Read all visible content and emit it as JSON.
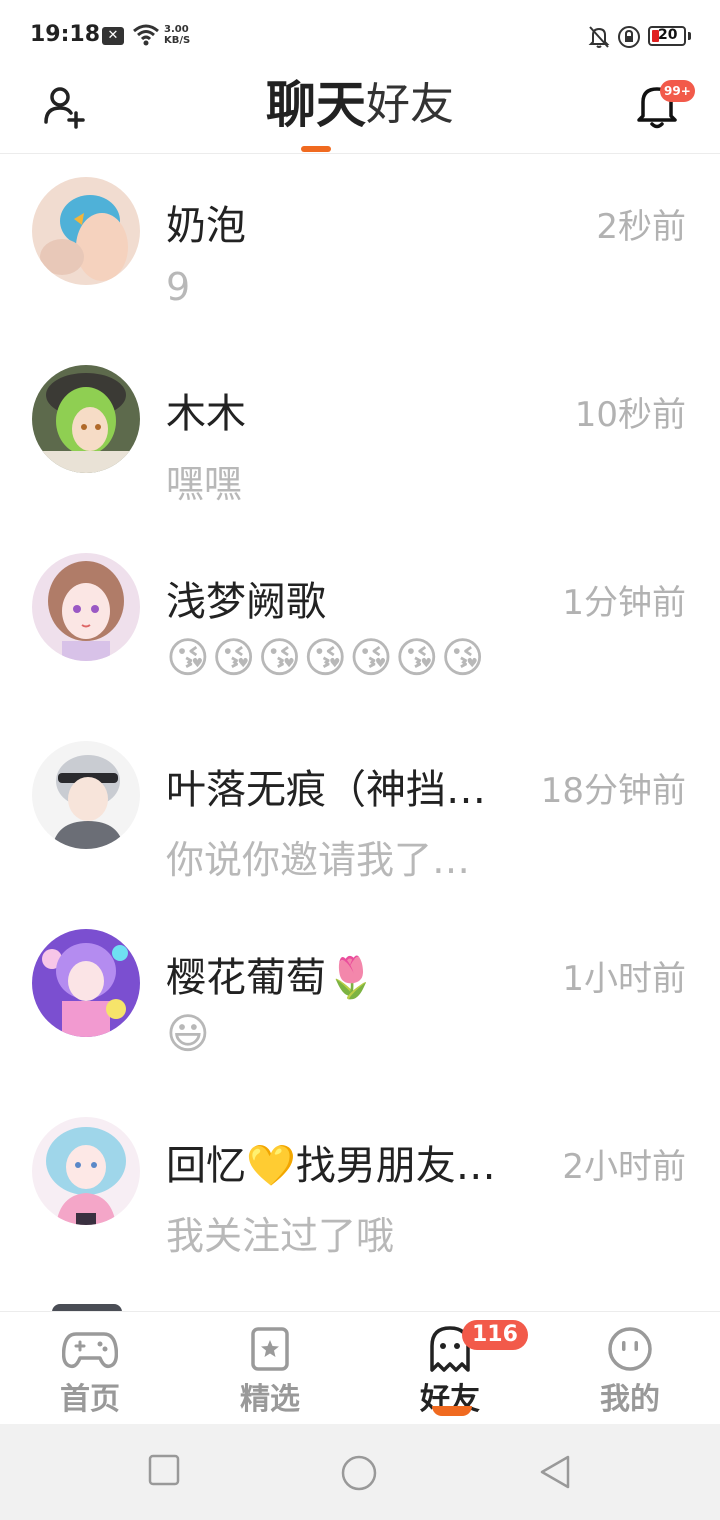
{
  "status_bar": {
    "time": "19:18",
    "notification_glyph": "✕",
    "net_speed_value": "3.00",
    "net_speed_unit": "KB/S",
    "battery": "20"
  },
  "header": {
    "tabs": [
      {
        "label": "聊天",
        "active": true
      },
      {
        "label": "好友",
        "active": false
      }
    ],
    "notification_badge": "99+"
  },
  "chats": [
    {
      "name": "奶泡",
      "time": "2秒前",
      "message": "9",
      "avatar": "blue-hair-girl"
    },
    {
      "name": "木木",
      "time": "10秒前",
      "message": "嘿嘿",
      "avatar": "green-hair-anime"
    },
    {
      "name": "浅梦阙歌",
      "time": "1分钟前",
      "message": "😘😘😘😘😘😘😘",
      "avatar": "brown-hair-anime"
    },
    {
      "name": "叶落无痕（神挡…",
      "time": "18分钟前",
      "message": "你说你邀请我了…",
      "avatar": "white-hair-boy"
    },
    {
      "name": "樱花葡萄🌷",
      "time": "1小时前",
      "message": "😃",
      "avatar": "purple-hair-anime"
    },
    {
      "name": "回忆💛找男朋友…",
      "time": "2小时前",
      "message": "我关注过了哦",
      "avatar": "pink-hair-anime"
    }
  ],
  "bottom_nav": [
    {
      "label": "首页",
      "icon": "gamepad-icon",
      "active": false
    },
    {
      "label": "精选",
      "icon": "star-card-icon",
      "active": false
    },
    {
      "label": "好友",
      "icon": "ghost-icon",
      "active": true,
      "badge": "116"
    },
    {
      "label": "我的",
      "icon": "smiley-icon",
      "active": false
    }
  ],
  "colors": {
    "accent": "#f06a20",
    "badge": "#f25a4a",
    "text_primary": "#222222",
    "text_secondary": "#b2b2b2"
  }
}
